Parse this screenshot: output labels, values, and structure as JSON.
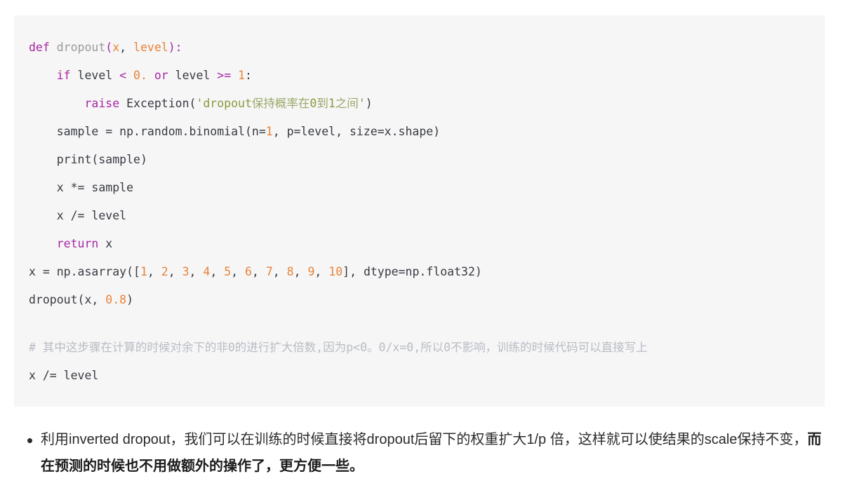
{
  "theme": {
    "page_background": "#ffffff",
    "code_background": "#f6f6f6",
    "keyword_color": "#a626a4",
    "function_name_color": "#9a9a9a",
    "number_color": "#e8833a",
    "string_color": "#8a9a3b",
    "comment_color": "#b9bcc4",
    "text_color": "#383a42",
    "bullet_text_color": "#2b2b2b"
  },
  "code_block": {
    "language": "python",
    "lines": [
      {
        "id": "line-1",
        "indent": 0,
        "tokens": [
          {
            "t": "def",
            "c": "kw"
          },
          {
            "t": " ",
            "c": "plain"
          },
          {
            "t": "dropout",
            "c": "fn"
          },
          {
            "t": "(",
            "c": "punc"
          },
          {
            "t": "x",
            "c": "param"
          },
          {
            "t": ", ",
            "c": "plain"
          },
          {
            "t": "level",
            "c": "param"
          },
          {
            "t": ")",
            "c": "punc"
          },
          {
            "t": ":",
            "c": "punc"
          }
        ]
      },
      {
        "id": "line-2",
        "indent": 1,
        "tokens": [
          {
            "t": "if",
            "c": "kw"
          },
          {
            "t": " level ",
            "c": "plain"
          },
          {
            "t": "<",
            "c": "op"
          },
          {
            "t": " ",
            "c": "plain"
          },
          {
            "t": "0.",
            "c": "num"
          },
          {
            "t": " ",
            "c": "plain"
          },
          {
            "t": "or",
            "c": "kw"
          },
          {
            "t": " level ",
            "c": "plain"
          },
          {
            "t": ">=",
            "c": "op"
          },
          {
            "t": " ",
            "c": "plain"
          },
          {
            "t": "1",
            "c": "num"
          },
          {
            "t": ":",
            "c": "plain"
          }
        ]
      },
      {
        "id": "line-3",
        "indent": 2,
        "tokens": [
          {
            "t": "raise",
            "c": "kw"
          },
          {
            "t": " ",
            "c": "plain"
          },
          {
            "t": "Exception",
            "c": "cls"
          },
          {
            "t": "(",
            "c": "plain"
          },
          {
            "t": "'dropout",
            "c": "str"
          },
          {
            "t": "保持概率在",
            "c": "strcjk"
          },
          {
            "t": "0",
            "c": "str"
          },
          {
            "t": "到",
            "c": "strcjk"
          },
          {
            "t": "1",
            "c": "str"
          },
          {
            "t": "之间",
            "c": "strcjk"
          },
          {
            "t": "'",
            "c": "str"
          },
          {
            "t": ")",
            "c": "plain"
          }
        ]
      },
      {
        "id": "line-4",
        "indent": 1,
        "tokens": [
          {
            "t": "sample = np.random.binomial(n=",
            "c": "plain"
          },
          {
            "t": "1",
            "c": "num"
          },
          {
            "t": ", p=level, size=x.shape)",
            "c": "plain"
          }
        ]
      },
      {
        "id": "line-5",
        "indent": 1,
        "tokens": [
          {
            "t": "print(sample)",
            "c": "plain"
          }
        ]
      },
      {
        "id": "line-6",
        "indent": 1,
        "tokens": [
          {
            "t": "x *= sample",
            "c": "plain"
          }
        ]
      },
      {
        "id": "line-7",
        "indent": 1,
        "tokens": [
          {
            "t": "x /= level",
            "c": "plain"
          }
        ]
      },
      {
        "id": "line-8",
        "indent": 1,
        "tokens": [
          {
            "t": "return",
            "c": "kw"
          },
          {
            "t": " x",
            "c": "plain"
          }
        ]
      },
      {
        "id": "line-9",
        "indent": 0,
        "tokens": [
          {
            "t": "x = np.asarray([",
            "c": "plain"
          },
          {
            "t": "1",
            "c": "num"
          },
          {
            "t": ", ",
            "c": "plain"
          },
          {
            "t": "2",
            "c": "num"
          },
          {
            "t": ", ",
            "c": "plain"
          },
          {
            "t": "3",
            "c": "num"
          },
          {
            "t": ", ",
            "c": "plain"
          },
          {
            "t": "4",
            "c": "num"
          },
          {
            "t": ", ",
            "c": "plain"
          },
          {
            "t": "5",
            "c": "num"
          },
          {
            "t": ", ",
            "c": "plain"
          },
          {
            "t": "6",
            "c": "num"
          },
          {
            "t": ", ",
            "c": "plain"
          },
          {
            "t": "7",
            "c": "num"
          },
          {
            "t": ", ",
            "c": "plain"
          },
          {
            "t": "8",
            "c": "num"
          },
          {
            "t": ", ",
            "c": "plain"
          },
          {
            "t": "9",
            "c": "num"
          },
          {
            "t": ", ",
            "c": "plain"
          },
          {
            "t": "10",
            "c": "num"
          },
          {
            "t": "], dtype=np.float32)",
            "c": "plain"
          }
        ]
      },
      {
        "id": "line-10",
        "indent": 0,
        "tokens": [
          {
            "t": "dropout(x, ",
            "c": "plain"
          },
          {
            "t": "0.8",
            "c": "num"
          },
          {
            "t": ")",
            "c": "plain"
          }
        ]
      },
      {
        "id": "line-11",
        "indent": 0,
        "gap": true,
        "tokens": [
          {
            "t": "# 其中这步骤在计算的时候对余下的非0的进行扩大倍数,因为p<0。0/x=0,所以0不影响，训练的时候代码可以直接写上",
            "c": "comment"
          }
        ]
      },
      {
        "id": "line-12",
        "indent": 0,
        "tokens": [
          {
            "t": "x /= level",
            "c": "plain"
          }
        ]
      }
    ]
  },
  "bullets": [
    {
      "id": "bullet-inverted-dropout",
      "segments": [
        {
          "text": "利用inverted dropout，我们可以在训练的时候直接将dropout后留下的权重扩大1/p 倍，这样就可以使结果的scale保持不变，",
          "bold": false
        },
        {
          "text": "而在预测的时候也不用做额外的操作了，更方便一些。",
          "bold": true
        }
      ]
    }
  ]
}
